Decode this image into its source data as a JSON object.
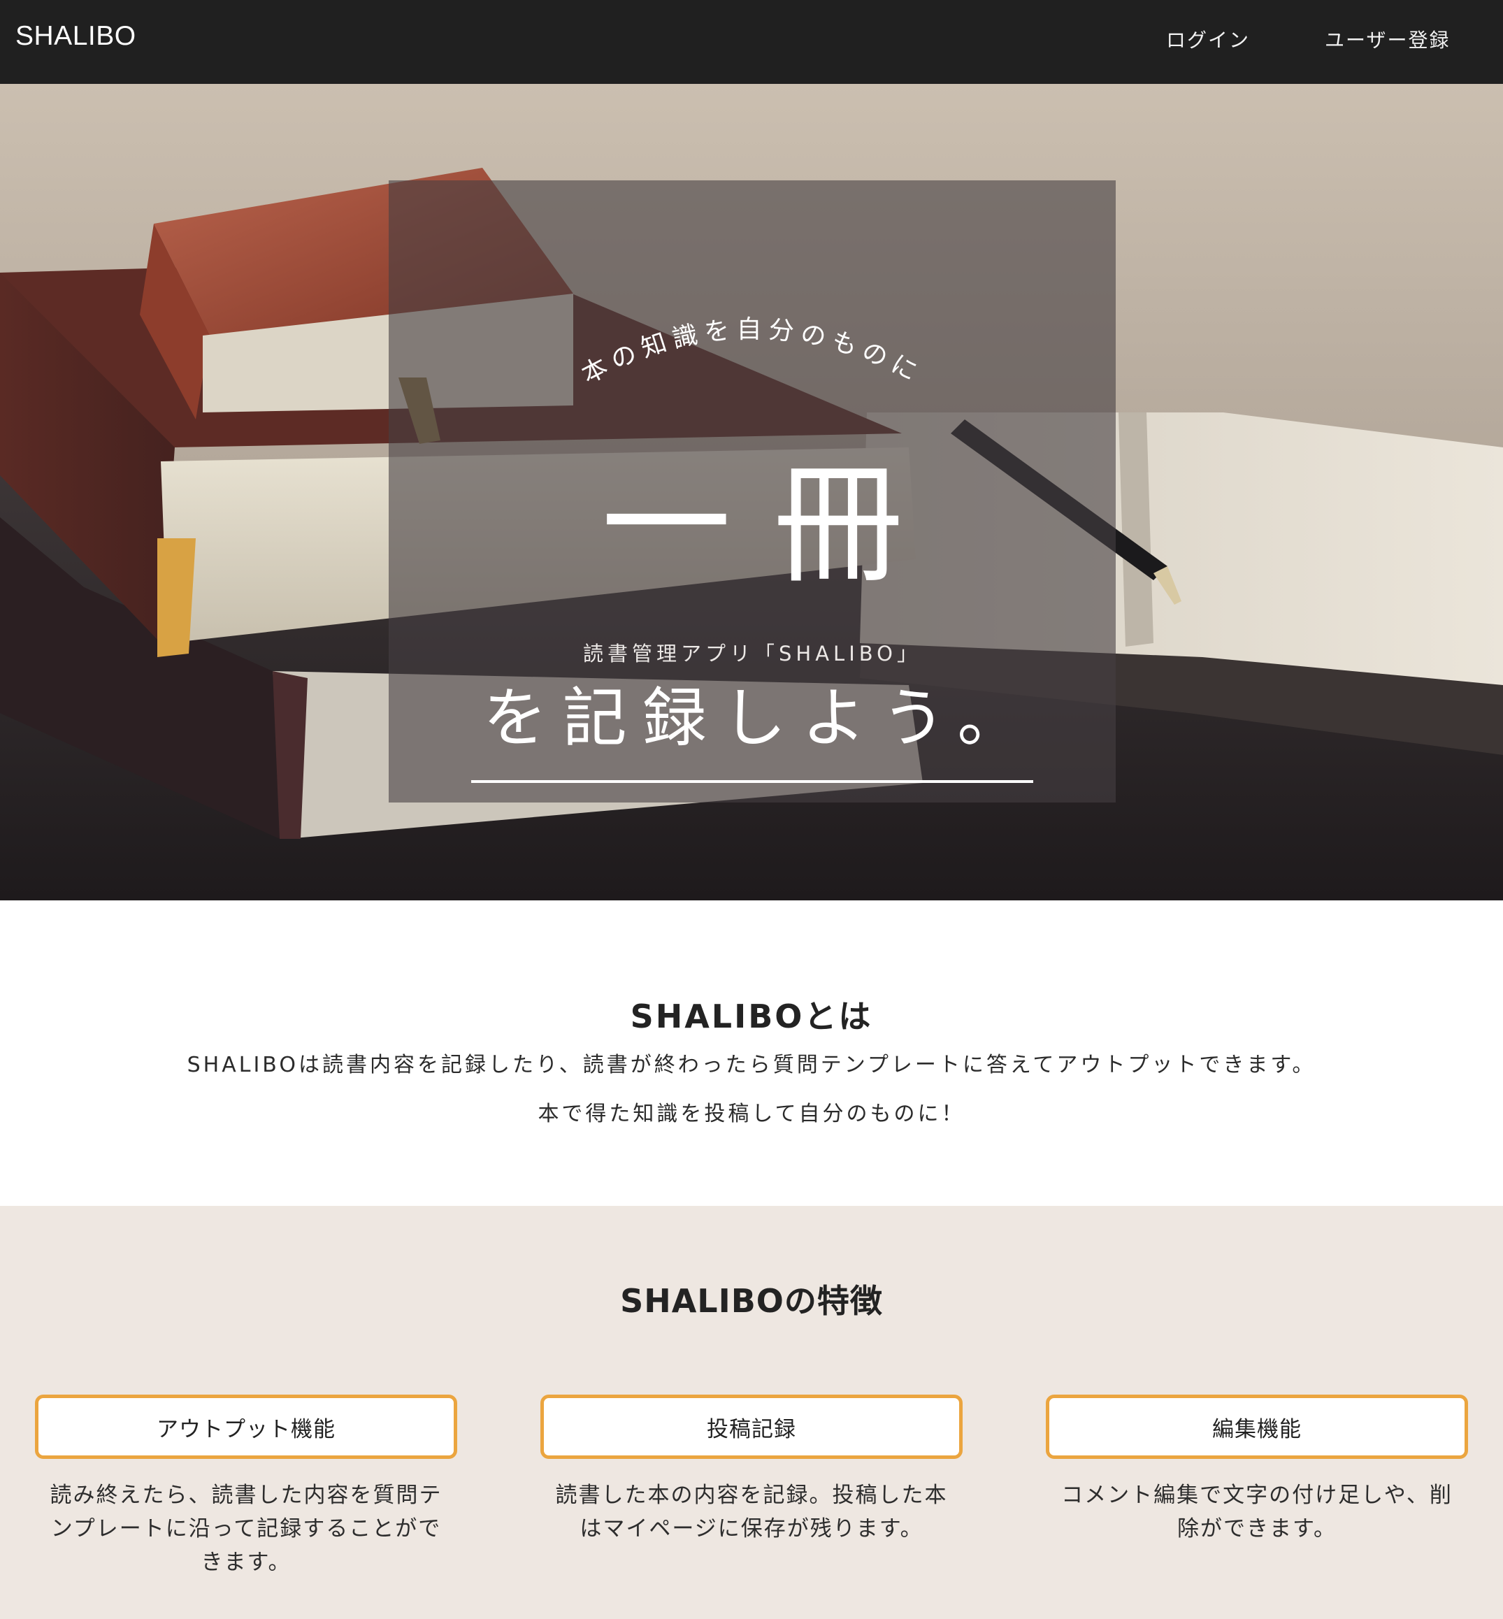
{
  "header": {
    "brand": "SHALIBO",
    "nav": {
      "login": "ログイン",
      "register": "ユーザー登録"
    },
    "background_color": "#202020"
  },
  "hero": {
    "tagline": "本の知識を自分のものに",
    "kanji": "一冊",
    "subtitle": "読書管理アプリ「SHALIBO」",
    "headline": "を記録しよう。",
    "background_image": "books-and-pen-photo"
  },
  "about": {
    "title": "SHALIBOとは",
    "line1": "SHALIBOは読書内容を記録したり、読書が終わったら質問テンプレートに答えてアウトプットできます。",
    "line2": "本で得た知識を投稿して自分のものに！"
  },
  "features": {
    "title": "SHALIBOの特徴",
    "items": [
      {
        "label": "アウトプット機能",
        "description": "読み終えたら、読書した内容を質問テンプレートに沿って記録することができます。"
      },
      {
        "label": "投稿記録",
        "description": "読書した本の内容を記録。投稿した本はマイページに保存が残ります。"
      },
      {
        "label": "編集機能",
        "description": "コメント編集で文字の付け足しや、削除ができます。"
      }
    ],
    "background_color": "#eee7e1",
    "accent_color": "#eba53f"
  }
}
